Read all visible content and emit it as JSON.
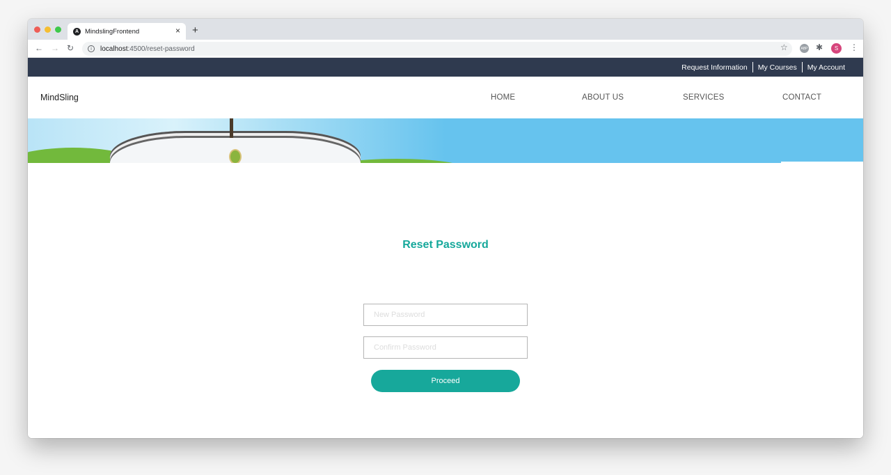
{
  "browser": {
    "tab_title": "MindslingFrontend",
    "tab_close": "×",
    "new_tab": "+",
    "url_host": "localhost",
    "url_path": ":4500/reset-password",
    "profile_initial": "S",
    "adblock_label": "ABP",
    "traffic_colors": [
      "#ee5e57",
      "#f5be32",
      "#3ec94a"
    ]
  },
  "topbar": {
    "links": [
      "Request Information",
      "My Courses",
      "My Account"
    ],
    "background": "#2f3a4f"
  },
  "navbar": {
    "brand": "MindSling",
    "links": [
      "HOME",
      "ABOUT US",
      "SERVICES",
      "CONTACT"
    ]
  },
  "form": {
    "title": "Reset Password",
    "new_password_placeholder": "New Password",
    "confirm_password_placeholder": "Confirm Password",
    "submit_label": "Proceed",
    "accent_color": "#17a89b"
  }
}
